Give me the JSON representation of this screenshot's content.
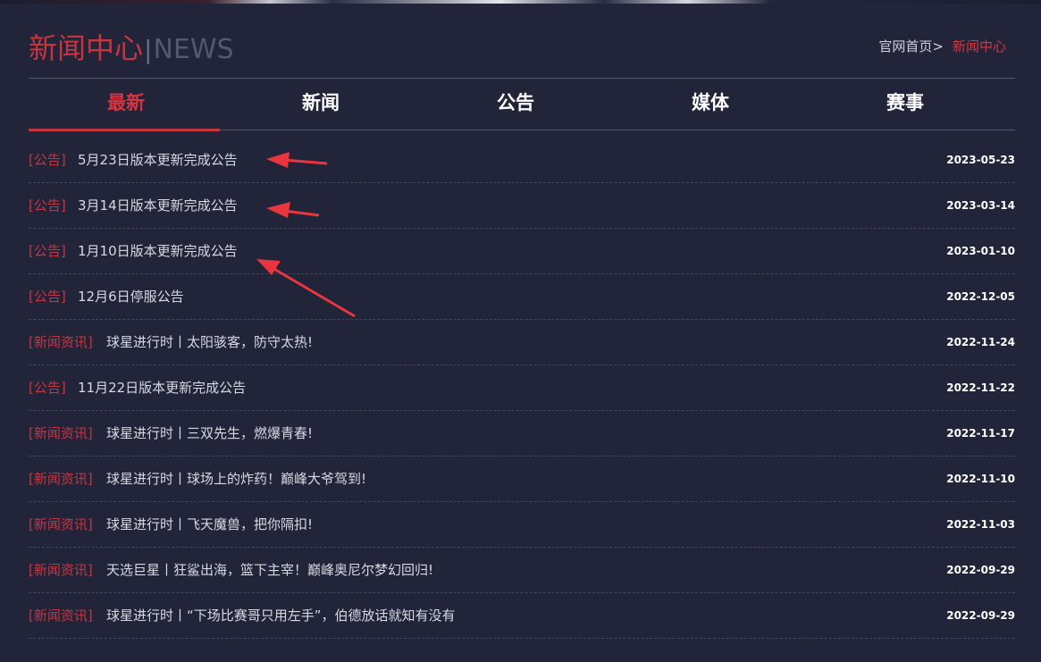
{
  "header": {
    "title_cn": "新闻中心",
    "title_sep": "|",
    "title_en": "NEWS",
    "breadcrumb_home": "官网首页",
    "breadcrumb_sep": ">",
    "breadcrumb_current": "新闻中心"
  },
  "tabs": [
    {
      "label": "最新",
      "active": true
    },
    {
      "label": "新闻",
      "active": false
    },
    {
      "label": "公告",
      "active": false
    },
    {
      "label": "媒体",
      "active": false
    },
    {
      "label": "赛事",
      "active": false
    }
  ],
  "news": [
    {
      "category": "[公告]",
      "title": "5月23日版本更新完成公告",
      "date": "2023-05-23"
    },
    {
      "category": "[公告]",
      "title": "3月14日版本更新完成公告",
      "date": "2023-03-14"
    },
    {
      "category": "[公告]",
      "title": "1月10日版本更新完成公告",
      "date": "2023-01-10"
    },
    {
      "category": "[公告]",
      "title": "12月6日停服公告",
      "date": "2022-12-05"
    },
    {
      "category": "[新闻资讯]",
      "title": "球星进行时丨太阳骇客，防守太热!",
      "date": "2022-11-24"
    },
    {
      "category": "[公告]",
      "title": "11月22日版本更新完成公告",
      "date": "2022-11-22"
    },
    {
      "category": "[新闻资讯]",
      "title": "球星进行时丨三双先生，燃爆青春!",
      "date": "2022-11-17"
    },
    {
      "category": "[新闻资讯]",
      "title": "球星进行时丨球场上的炸药！巅峰大爷驾到!",
      "date": "2022-11-10"
    },
    {
      "category": "[新闻资讯]",
      "title": "球星进行时丨飞天魔兽，把你隔扣!",
      "date": "2022-11-03"
    },
    {
      "category": "[新闻资讯]",
      "title": "天选巨星丨狂鲨出海，篮下主宰！巅峰奥尼尔梦幻回归!",
      "date": "2022-09-29"
    },
    {
      "category": "[新闻资讯]",
      "title": "球星进行时丨“下场比赛哥只用左手”，伯德放话就知有没有",
      "date": "2022-09-29"
    }
  ],
  "colors": {
    "background": "#22243a",
    "accent": "#c8353f",
    "annotation_arrow": "#e8353e"
  },
  "annotations": [
    "arrow-1",
    "arrow-2",
    "arrow-3"
  ]
}
